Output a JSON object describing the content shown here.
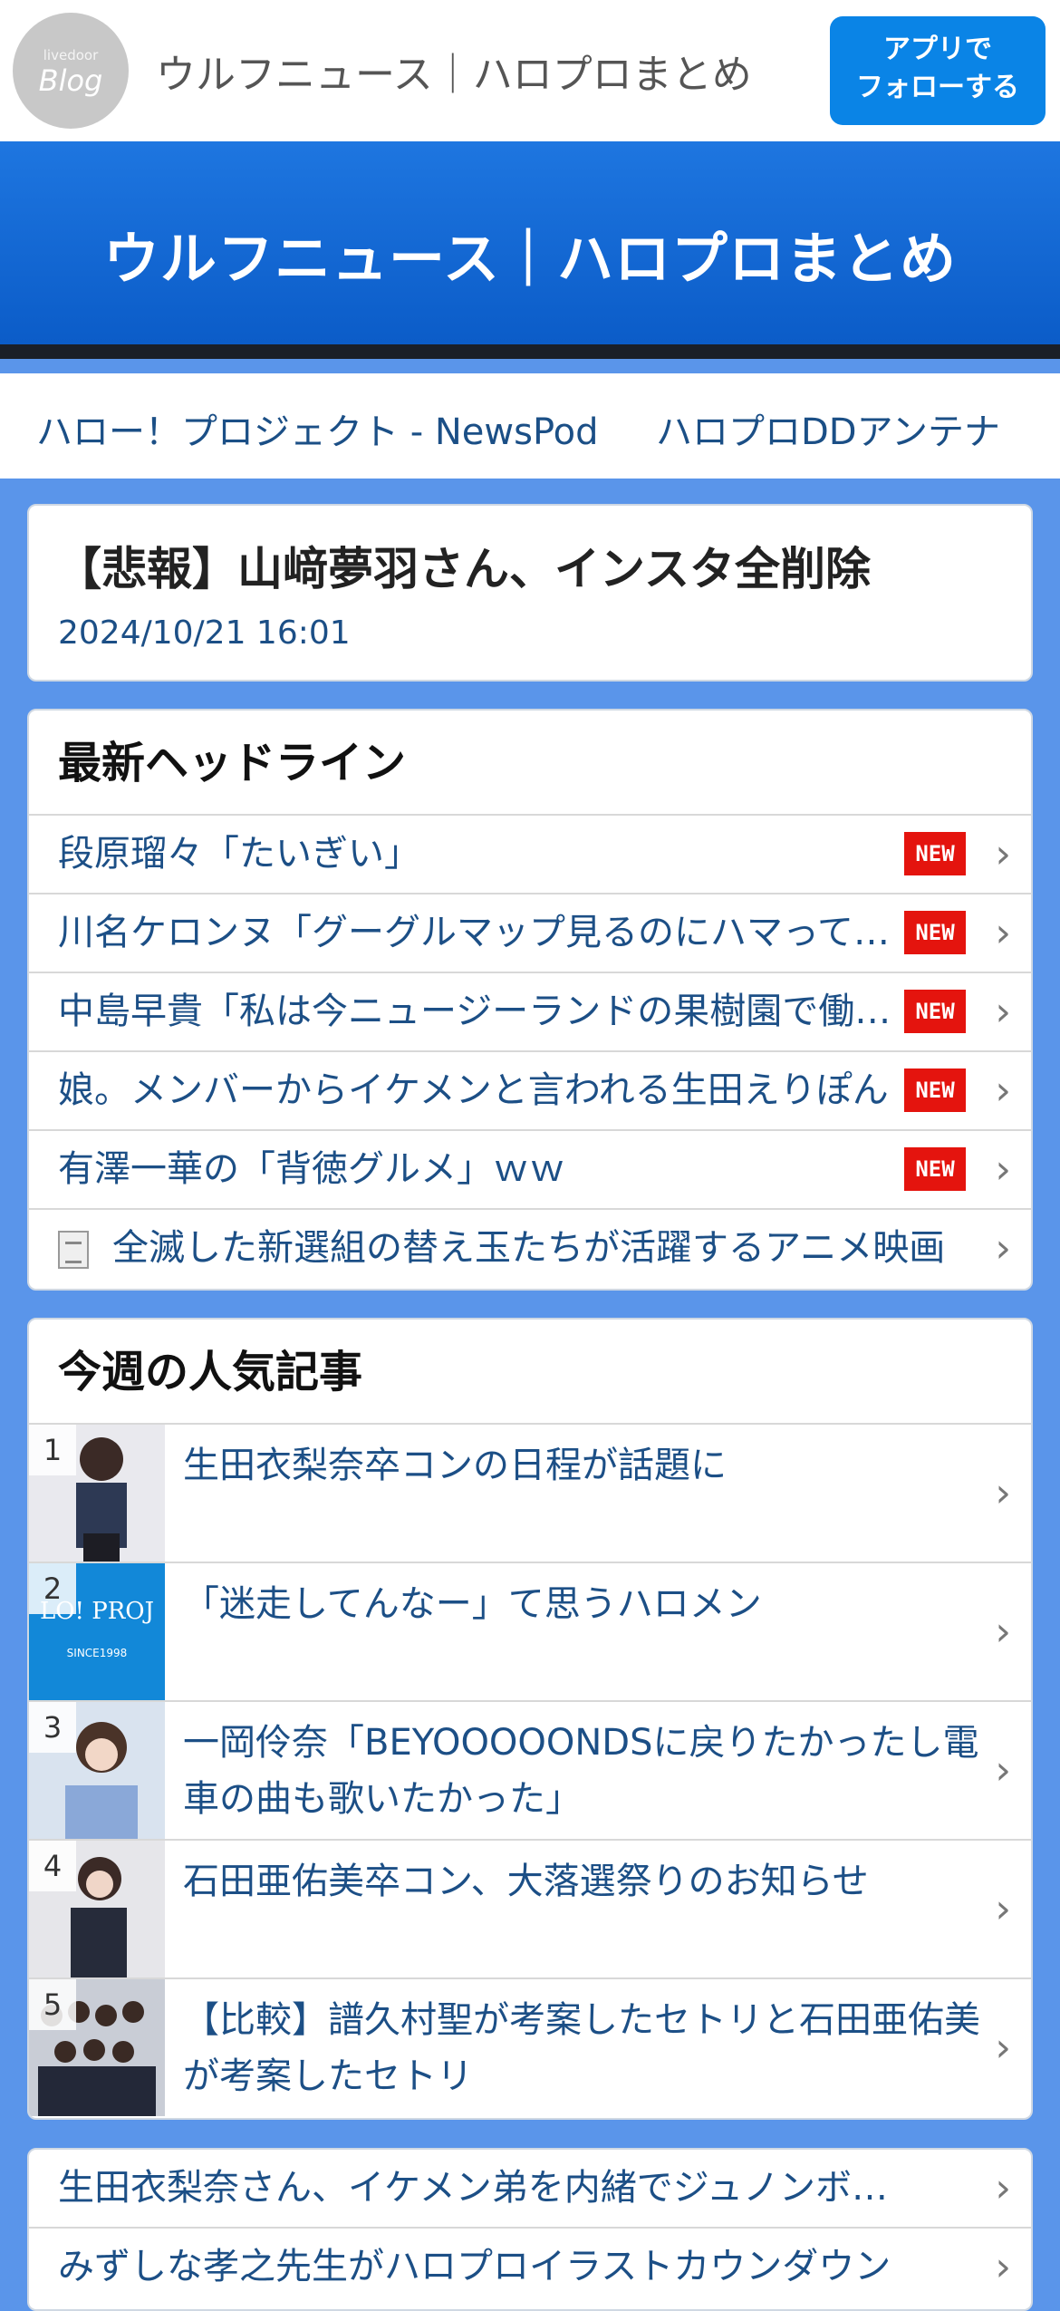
{
  "header": {
    "logo_small": "livedoor",
    "logo_big": "Blog",
    "site_name": "ウルフニュース｜ハロプロまとめ",
    "follow_line1": "アプリで",
    "follow_line2": "フォローする"
  },
  "banner": {
    "title": "ウルフニュース｜ハロプロまとめ"
  },
  "links": [
    "ハロー！プロジェクト - NewsPod",
    "ハロプロDDアンテナ"
  ],
  "article": {
    "title": "【悲報】山﨑夢羽さん、インスタ全削除",
    "date": "2024/10/21 16:01"
  },
  "headlines": {
    "heading": "最新ヘッドライン",
    "badge": "NEW",
    "items": [
      "段原瑠々「たいぎい」",
      "川名ケロンヌ「グーグルマップ見るのにハマってる」",
      "中島早貴「私は今ニュージーランドの果樹園で働いてます」",
      "娘。メンバーからイケメンと言われる生田えりぽん",
      "有澤一華の「背徳グルメ」ｗｗ",
      "全滅した新選組の替え玉たちが活躍するアニメ映画"
    ]
  },
  "popular": {
    "heading": "今週の人気記事",
    "items": [
      {
        "rank": "1",
        "title": "生田衣梨奈卒コンの日程が話題に"
      },
      {
        "rank": "2",
        "title": "「迷走してんなー」て思うハロメン",
        "thumb_text": "LO! PROJ",
        "thumb_sub": "SINCE1998"
      },
      {
        "rank": "3",
        "title": "一岡伶奈「BEYOOOOONDSに戻りたかったし電車の曲も歌いたかった」"
      },
      {
        "rank": "4",
        "title": "石田亜佑美卒コン、大落選祭りのお知らせ"
      },
      {
        "rank": "5",
        "title": "【比較】譜久村聖が考案したセトリと石田亜佑美が考案したセトリ"
      }
    ]
  },
  "more": {
    "items": [
      "生田衣梨奈さん、イケメン弟を内緒でジュノンボーイに応募",
      "みずしな孝之先生がハロプロイラストカウンダウン"
    ]
  },
  "chevron": "›"
}
